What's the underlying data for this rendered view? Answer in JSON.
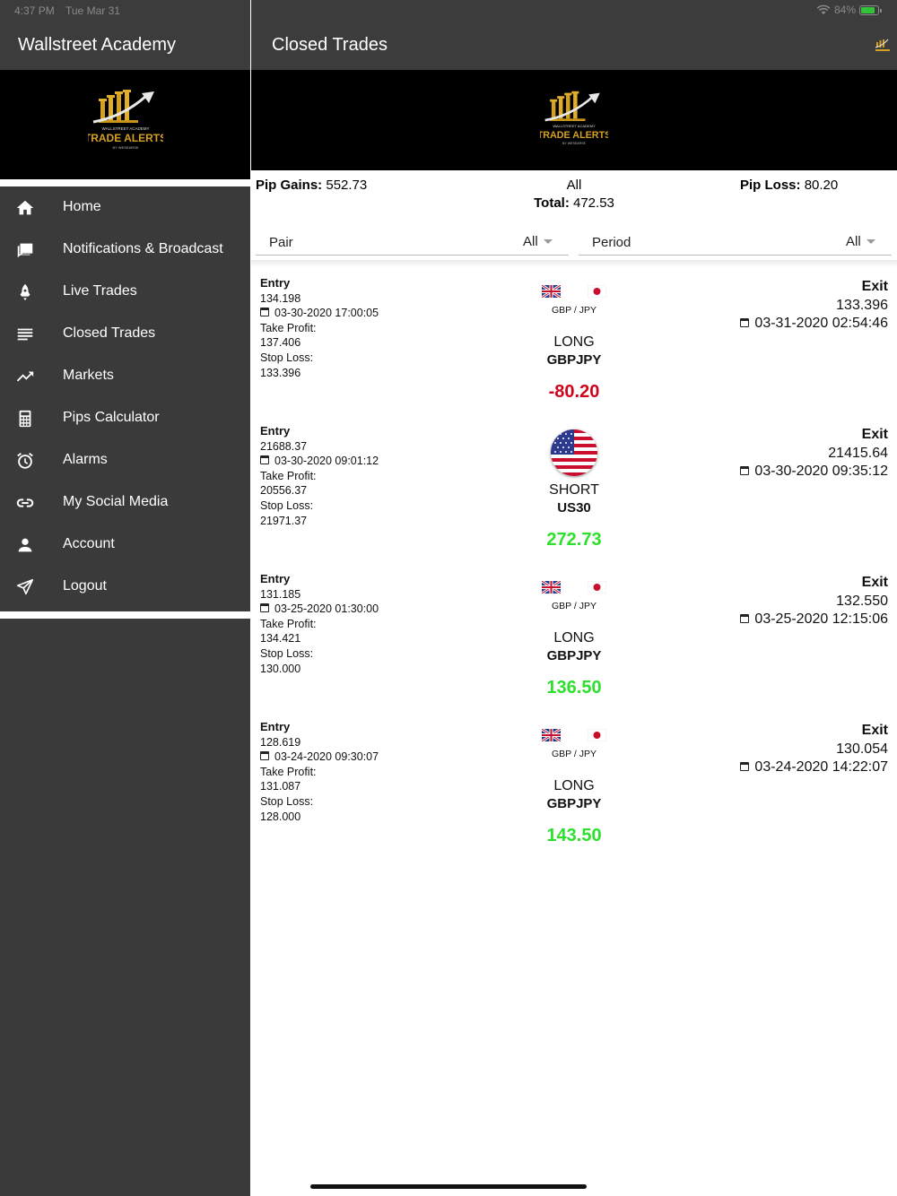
{
  "status_bar": {
    "time": "4:37 PM",
    "date": "Tue Mar 31",
    "battery": "84%",
    "battery_level": 0.84
  },
  "sidebar": {
    "title": "Wallstreet Academy",
    "items": [
      {
        "label": "Home",
        "icon": "home-icon"
      },
      {
        "label": "Notifications & Broadcast",
        "icon": "chat-icon"
      },
      {
        "label": "Live Trades",
        "icon": "rocket-icon"
      },
      {
        "label": "Closed Trades",
        "icon": "list-icon"
      },
      {
        "label": "Markets",
        "icon": "trending-up-icon"
      },
      {
        "label": "Pips Calculator",
        "icon": "calculator-icon"
      },
      {
        "label": "Alarms",
        "icon": "alarm-icon"
      },
      {
        "label": "My Social Media",
        "icon": "link-icon"
      },
      {
        "label": "Account",
        "icon": "person-icon"
      },
      {
        "label": "Logout",
        "icon": "send-icon"
      }
    ]
  },
  "logo": {
    "top_text": "WALLSTREET ACADEMY",
    "main_text": "TRADE ALERTS",
    "bottom_text": "BY WESEARSE"
  },
  "main": {
    "title": "Closed Trades",
    "summary": {
      "pip_gains_label": "Pip Gains:",
      "pip_gains_value": "552.73",
      "filter_all": "All",
      "total_label": "Total:",
      "total_value": "472.53",
      "pip_loss_label": "Pip Loss:",
      "pip_loss_value": "80.20"
    },
    "filters": {
      "pair_label": "Pair",
      "pair_value": "All",
      "period_label": "Period",
      "period_value": "All"
    },
    "labels": {
      "entry": "Entry",
      "take_profit": "Take Profit:",
      "stop_loss": "Stop Loss:",
      "exit": "Exit"
    },
    "trades": [
      {
        "entry_price": "134.198",
        "entry_date": "03-30-2020 17:00:05",
        "take_profit": "137.406",
        "stop_loss": "133.396",
        "pair_code": "GBP / JPY",
        "direction": "LONG",
        "symbol": "GBPJPY",
        "pips": "-80.20",
        "exit_price": "133.396",
        "exit_date": "03-31-2020 02:54:46",
        "flag": "gbp-jpy"
      },
      {
        "entry_price": "21688.37",
        "entry_date": "03-30-2020 09:01:12",
        "take_profit": "20556.37",
        "stop_loss": "21971.37",
        "pair_code": "",
        "direction": "SHORT",
        "symbol": "US30",
        "pips": "272.73",
        "exit_price": "21415.64",
        "exit_date": "03-30-2020 09:35:12",
        "flag": "us"
      },
      {
        "entry_price": "131.185",
        "entry_date": "03-25-2020 01:30:00",
        "take_profit": "134.421",
        "stop_loss": "130.000",
        "pair_code": "GBP / JPY",
        "direction": "LONG",
        "symbol": "GBPJPY",
        "pips": "136.50",
        "exit_price": "132.550",
        "exit_date": "03-25-2020 12:15:06",
        "flag": "gbp-jpy"
      },
      {
        "entry_price": "128.619",
        "entry_date": "03-24-2020 09:30:07",
        "take_profit": "131.087",
        "stop_loss": "128.000",
        "pair_code": "GBP / JPY",
        "direction": "LONG",
        "symbol": "GBPJPY",
        "pips": "143.50",
        "exit_price": "130.054",
        "exit_date": "03-24-2020 14:22:07",
        "flag": "gbp-jpy"
      }
    ]
  },
  "colors": {
    "header_bg": "#3c3c3c",
    "sidebar_bg": "#3a3a3a",
    "loss": "#d0021b",
    "gain": "#2ee02e",
    "gold": "#d4a020"
  }
}
